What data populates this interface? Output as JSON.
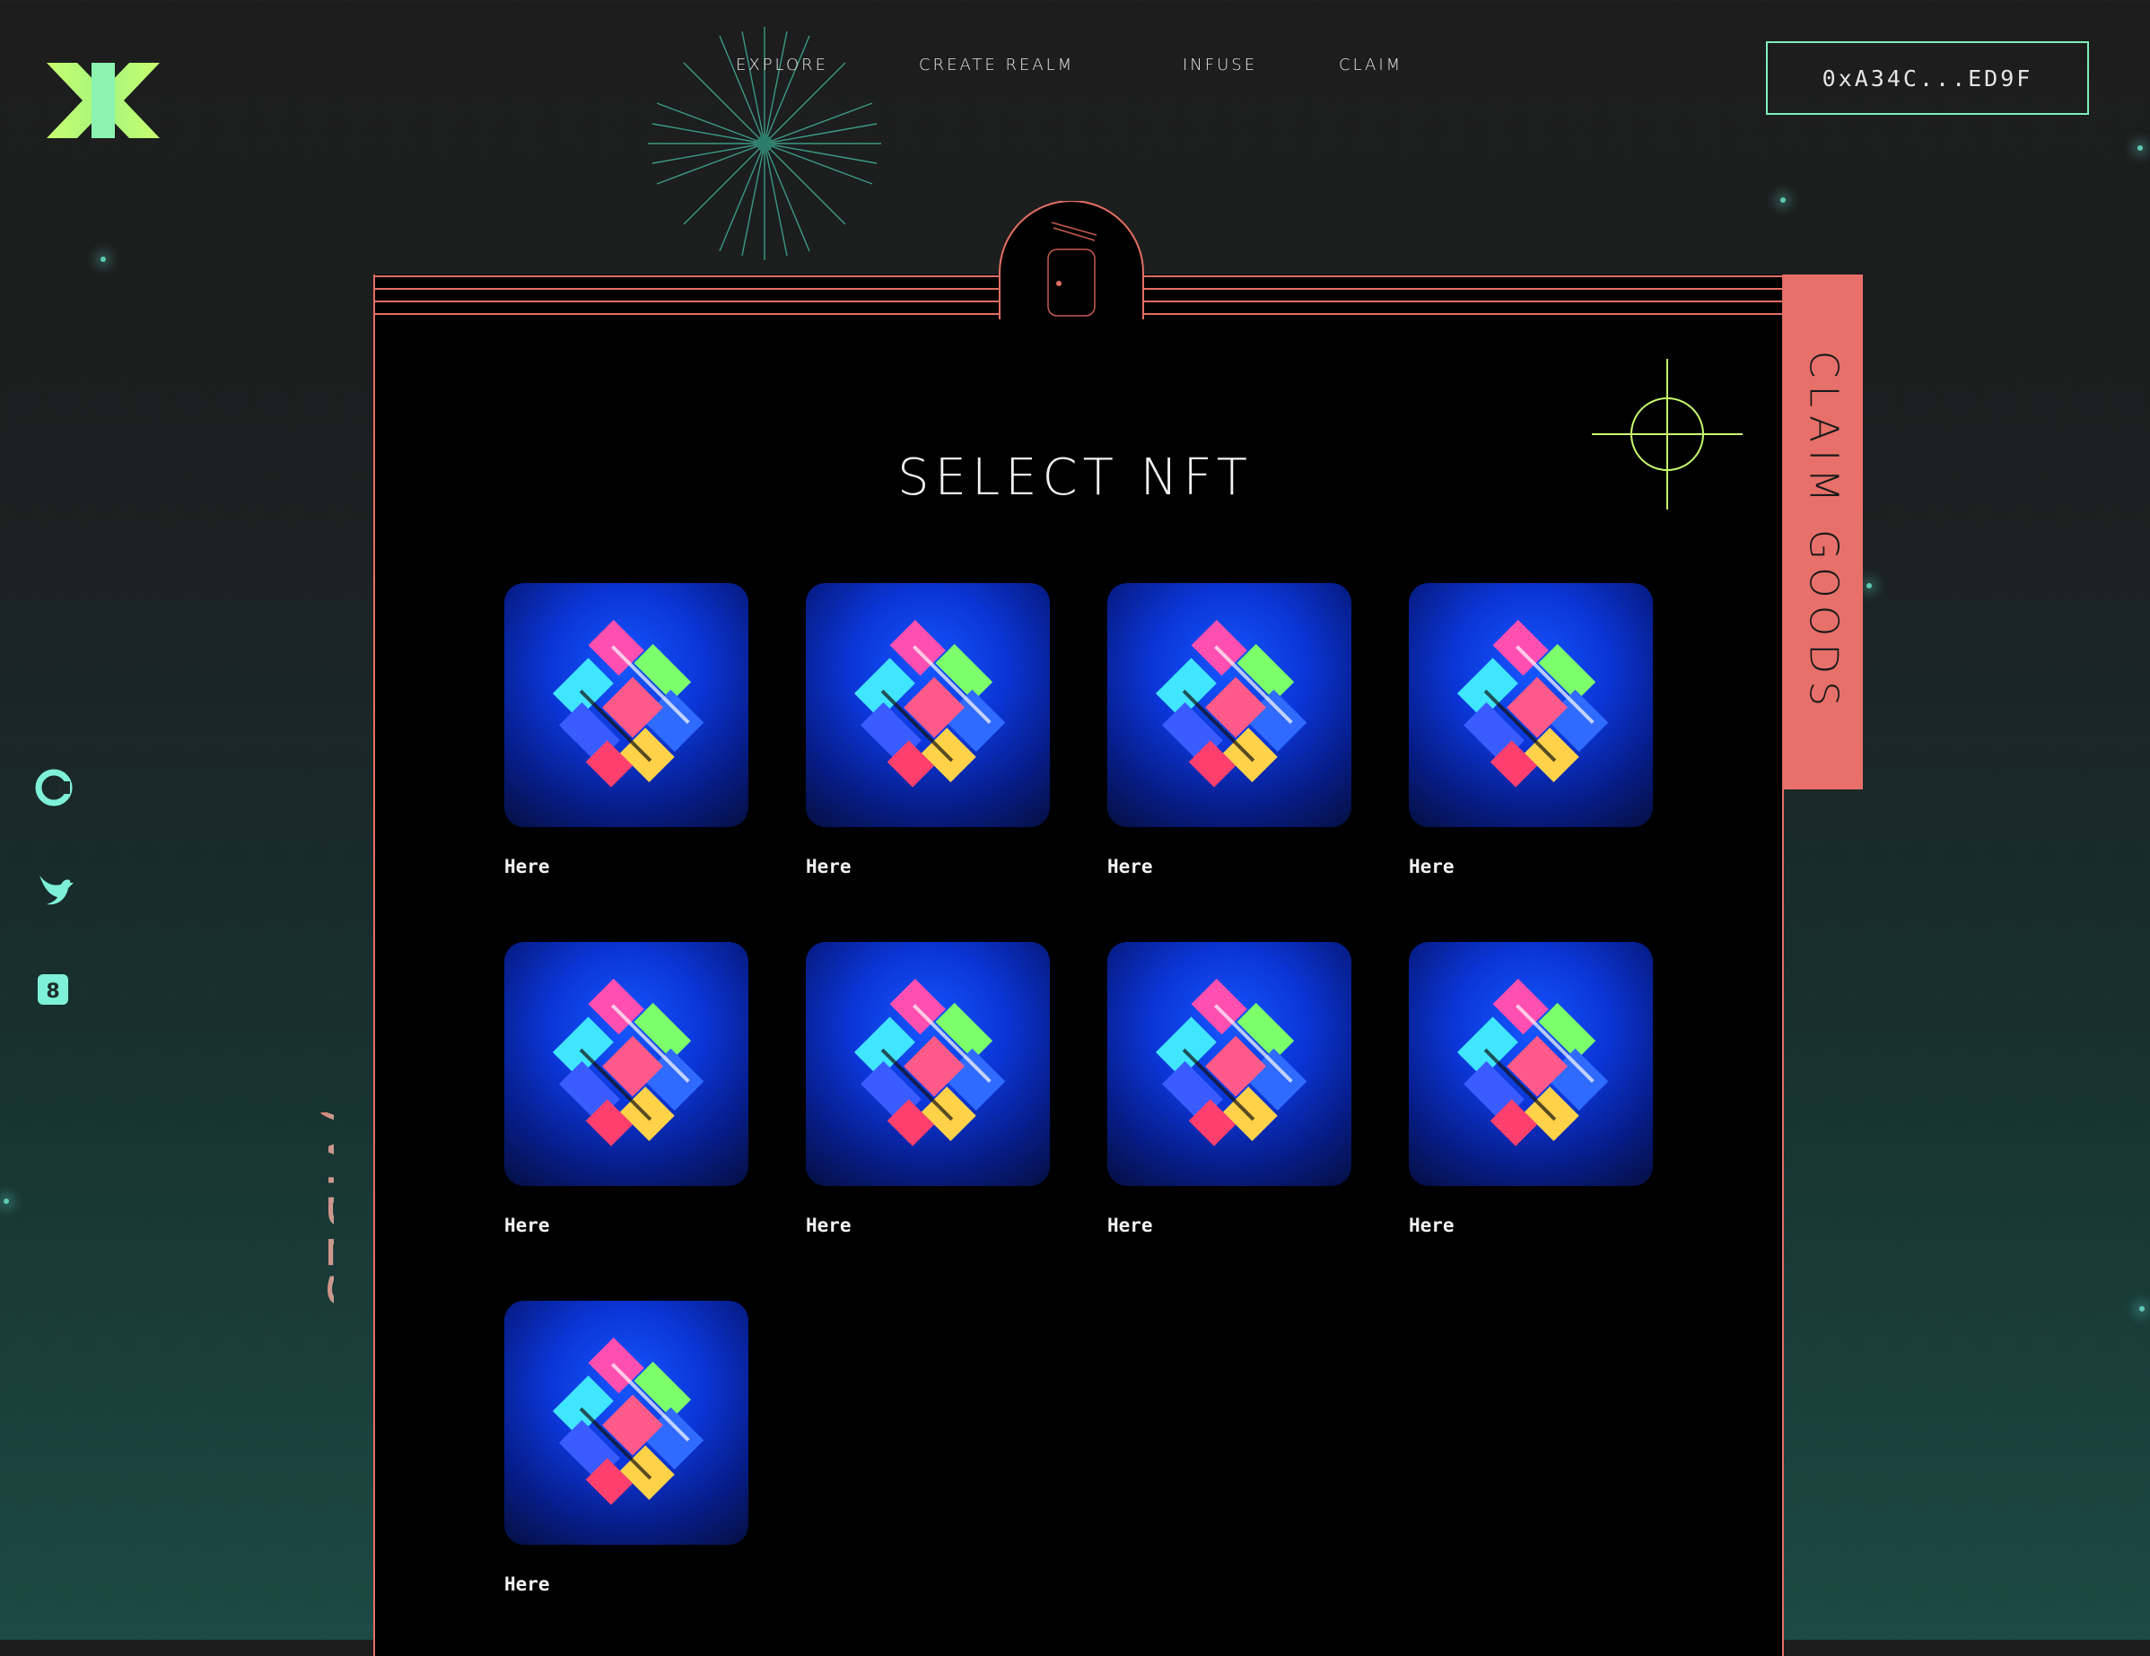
{
  "header": {
    "logo": "x-logo-icon",
    "nav": [
      {
        "label": "EXPLORE"
      },
      {
        "label": "CREATE REALM"
      },
      {
        "label": "INFUSE"
      },
      {
        "label": "CLAIM"
      }
    ],
    "wallet_address": "0xA34C...ED9F"
  },
  "sidebar": {
    "socials": [
      "coingecko-icon",
      "twitter-bird-icon",
      "opensea-icon"
    ],
    "brand_text": "PER)VIBES"
  },
  "panel": {
    "title": "SELECT NFT",
    "side_tab_label": "CLAIM GOODS",
    "nfts": [
      {
        "label": "Here"
      },
      {
        "label": "Here"
      },
      {
        "label": "Here"
      },
      {
        "label": "Here"
      },
      {
        "label": "Here"
      },
      {
        "label": "Here"
      },
      {
        "label": "Here"
      },
      {
        "label": "Here"
      },
      {
        "label": "Here"
      }
    ]
  },
  "colors": {
    "accent_green": "#7ef0b8",
    "accent_coral": "#e8706a",
    "logo_lime": "#c8ff6e",
    "nft_blue": "#0b36d8"
  }
}
